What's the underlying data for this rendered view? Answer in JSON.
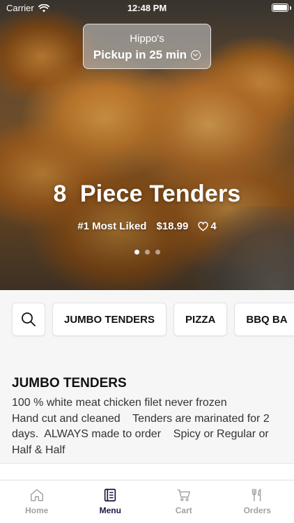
{
  "status_bar": {
    "carrier": "Carrier",
    "time": "12:48 PM"
  },
  "pickup": {
    "store": "Hippo's",
    "time_text": "Pickup in 25 min",
    "icon": "chevron-down-circle-icon"
  },
  "hero": {
    "title": "8  Piece Tenders",
    "badge": "#1 Most Liked",
    "price": "$18.99",
    "likes": "4",
    "carousel_pages": 3,
    "active_page": 1
  },
  "categories": {
    "search_icon": "search-icon",
    "items": [
      "JUMBO TENDERS",
      "PIZZA",
      "BBQ BA"
    ]
  },
  "section": {
    "title": "JUMBO TENDERS",
    "description": "100 % white meat chicken filet never frozen\nHand cut and cleaned    Tenders are marinated for 2 days.  ALWAYS made to order    Spicy or Regular or Half & Half"
  },
  "tabs": [
    {
      "label": "Home",
      "icon": "home-icon",
      "active": false
    },
    {
      "label": "Menu",
      "icon": "menu-icon",
      "active": true
    },
    {
      "label": "Cart",
      "icon": "cart-icon",
      "active": false
    },
    {
      "label": "Orders",
      "icon": "fork-knife-icon",
      "active": false
    }
  ],
  "colors": {
    "active_tab": "#1d1540",
    "inactive_tab": "#a2a2a2"
  }
}
